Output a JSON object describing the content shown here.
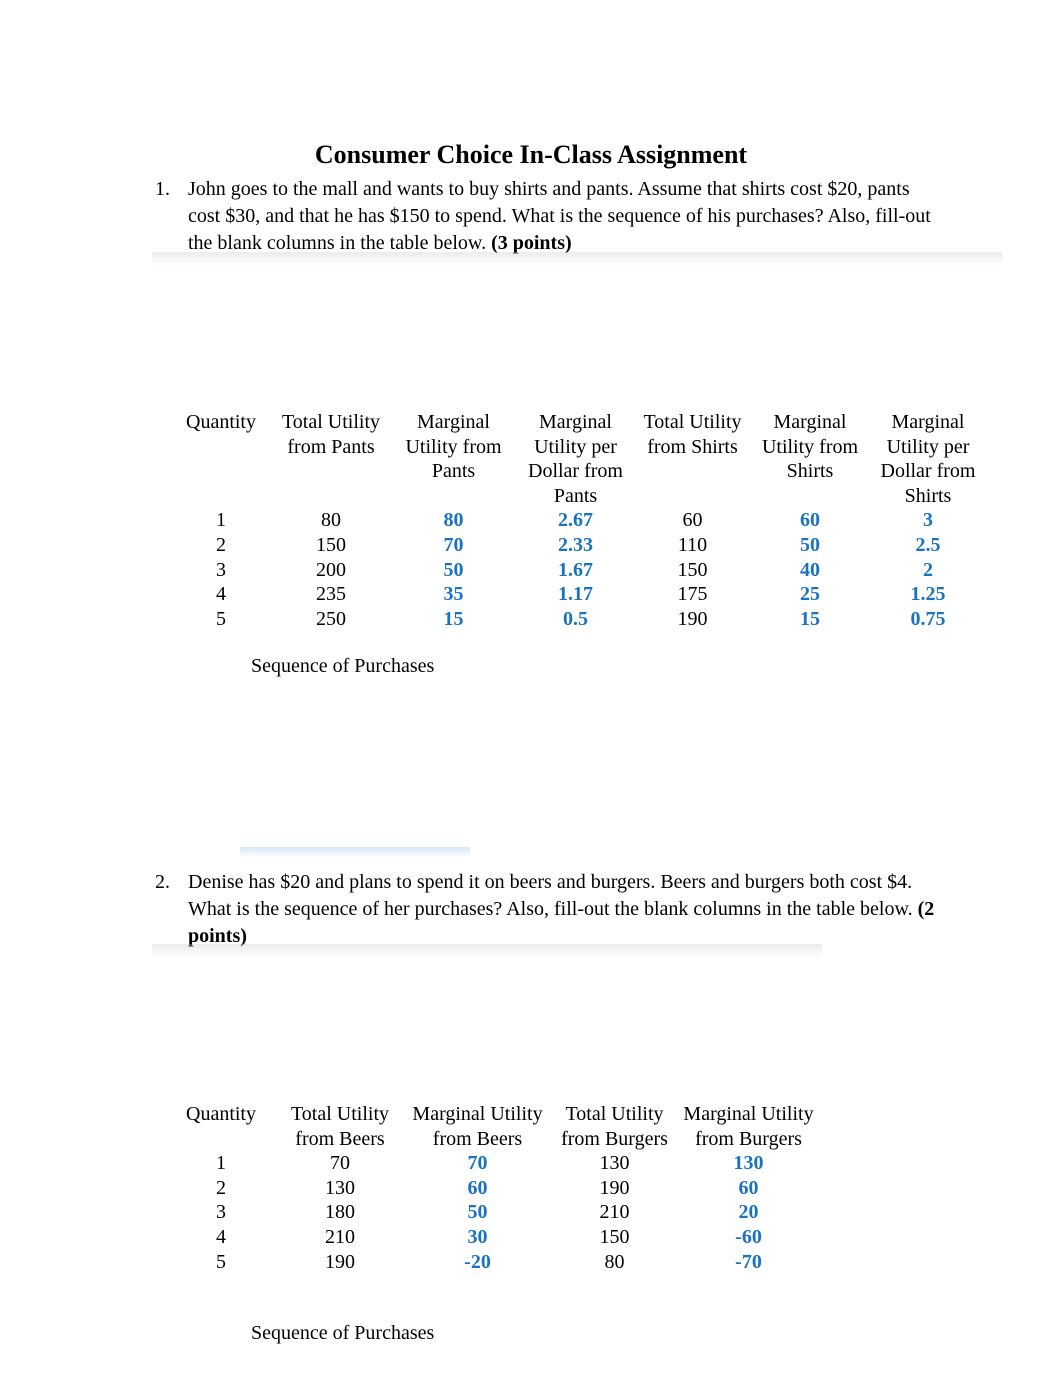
{
  "document": {
    "title": "Consumer Choice In-Class Assignment"
  },
  "questions": [
    {
      "number": "1.",
      "text": "John goes to the mall and wants to buy shirts and pants.  Assume that shirts cost $20, pants cost $30, and that he has $150 to spend.  What is the sequence of his purchases?  Also, fill-out the blank columns in the table below.  ",
      "points": "(3 points)",
      "sequence_label": "Sequence of Purchases",
      "table": {
        "headers": [
          "Quantity",
          "Total Utility from Pants",
          "Marginal Utility from Pants",
          "Marginal Utility per Dollar from Pants",
          "Total Utility from Shirts",
          "Marginal Utility from Shirts",
          "Marginal Utility per Dollar from Shirts"
        ],
        "rows": [
          [
            "1",
            "80",
            "80",
            "2.67",
            "60",
            "60",
            "3"
          ],
          [
            "2",
            "150",
            "70",
            "2.33",
            "110",
            "50",
            "2.5"
          ],
          [
            "3",
            "200",
            "50",
            "1.67",
            "150",
            "40",
            "2"
          ],
          [
            "4",
            "235",
            "35",
            "1.17",
            "175",
            "25",
            "1.25"
          ],
          [
            "5",
            "250",
            "15",
            "0.5",
            "190",
            "15",
            "0.75"
          ]
        ]
      }
    },
    {
      "number": "2.",
      "text": "Denise has $20 and plans to spend it on beers and burgers.  Beers and burgers both cost $4.  What is the sequence of her purchases?  Also, fill-out the blank columns in the table below. ",
      "points": "(2 points)",
      "sequence_label": "Sequence of Purchases",
      "table": {
        "headers": [
          "Quantity",
          "Total Utility from Beers",
          "Marginal Utility from Beers",
          "Total Utility from Burgers",
          "Marginal Utility from Burgers"
        ],
        "rows": [
          [
            "1",
            "70",
            "70",
            "130",
            "130"
          ],
          [
            "2",
            "130",
            "60",
            "190",
            "60"
          ],
          [
            "3",
            "180",
            "50",
            "210",
            "20"
          ],
          [
            "4",
            "210",
            "30",
            "150",
            "-60"
          ],
          [
            "5",
            "190",
            "-20",
            "80",
            "-70"
          ]
        ]
      }
    }
  ],
  "colors": {
    "answer_text": "#1a73c0",
    "body_text": "#000000"
  }
}
